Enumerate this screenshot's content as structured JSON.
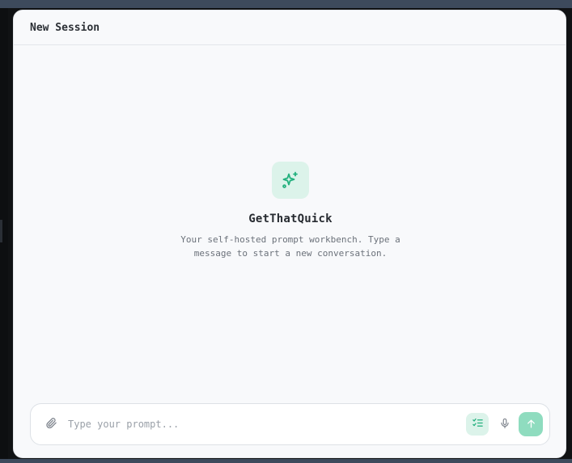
{
  "session": {
    "title": "New Session"
  },
  "hero": {
    "icon": "sparkles-icon",
    "name": "GetThatQuick",
    "description": "Your self-hosted prompt workbench. Type a message to start a new conversation."
  },
  "composer": {
    "placeholder": "Type your prompt...",
    "attach_icon": "paperclip-icon",
    "task_icon": "checklist-icon",
    "mic_icon": "microphone-icon",
    "send_icon": "arrow-up-icon"
  },
  "colors": {
    "accent": "#22b07d",
    "accent_soft": "#dcf3ea",
    "send": "#8fdcbf",
    "panel": "#f8f9fb"
  }
}
